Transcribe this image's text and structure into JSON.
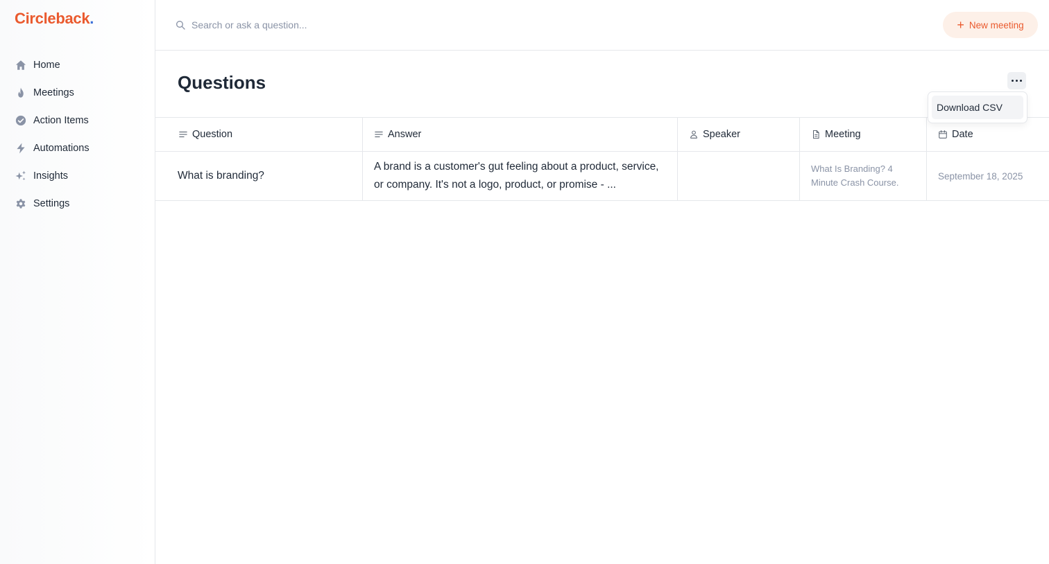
{
  "app": {
    "logo": "Circleback",
    "logo_dot": ".",
    "accent_color": "#ea5a2e"
  },
  "sidebar": {
    "items": [
      {
        "label": "Home",
        "icon": "home-icon"
      },
      {
        "label": "Meetings",
        "icon": "flame-icon"
      },
      {
        "label": "Action Items",
        "icon": "check-circle-icon"
      },
      {
        "label": "Automations",
        "icon": "lightning-icon"
      },
      {
        "label": "Insights",
        "icon": "sparkles-icon"
      },
      {
        "label": "Settings",
        "icon": "gear-icon"
      }
    ]
  },
  "topbar": {
    "search_placeholder": "Search or ask a question...",
    "new_meeting_label": "New meeting"
  },
  "page": {
    "title": "Questions",
    "menu": {
      "download_csv": "Download CSV"
    }
  },
  "table": {
    "columns": [
      "Question",
      "Answer",
      "Speaker",
      "Meeting",
      "Date"
    ],
    "rows": [
      {
        "question": "What is branding?",
        "answer": "A brand is a customer's gut feeling about a product, service, or company. It's not a logo, product, or promise - ...",
        "speaker": "",
        "meeting": "What Is Branding? 4 Minute Crash Course.",
        "date": "September 18, 2025"
      }
    ]
  }
}
